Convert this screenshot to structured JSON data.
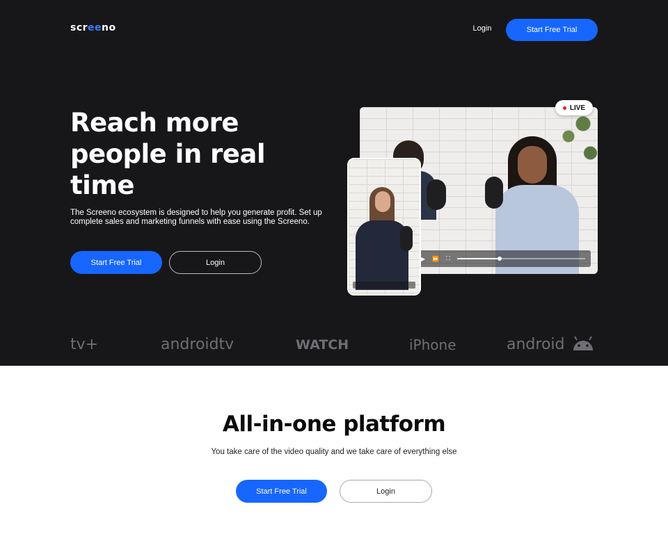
{
  "brand": {
    "logo_prefix": "scr",
    "logo_accent": "ee",
    "logo_suffix": "no",
    "accent_color": "#1766ff",
    "hero_background": "#17171a"
  },
  "nav": {
    "login_label": "Login",
    "cta_label": "Start Free Trial"
  },
  "hero": {
    "title": "Reach more people in real time",
    "description": "The Screeno ecosystem is designed to help you generate profit. Set up complete sales and marketing funnels with ease using the Screeno.",
    "primary_button": "Start Free Trial",
    "secondary_button": "Login",
    "live_badge": "LIVE"
  },
  "platforms": [
    {
      "name": "tv+",
      "icon": "apple-icon"
    },
    {
      "name": "androidtv",
      "icon": ""
    },
    {
      "name": "WATCH",
      "icon": "apple-icon"
    },
    {
      "name": "iPhone",
      "icon": ""
    },
    {
      "name": "android",
      "icon": "android-robot-icon"
    }
  ],
  "section": {
    "title": "All-in-one platform",
    "subtitle": "You take care of the video quality and we take care of everything else",
    "primary_button": "Start Free Trial",
    "secondary_button": "Login"
  },
  "player": {
    "progress": 0.33
  }
}
